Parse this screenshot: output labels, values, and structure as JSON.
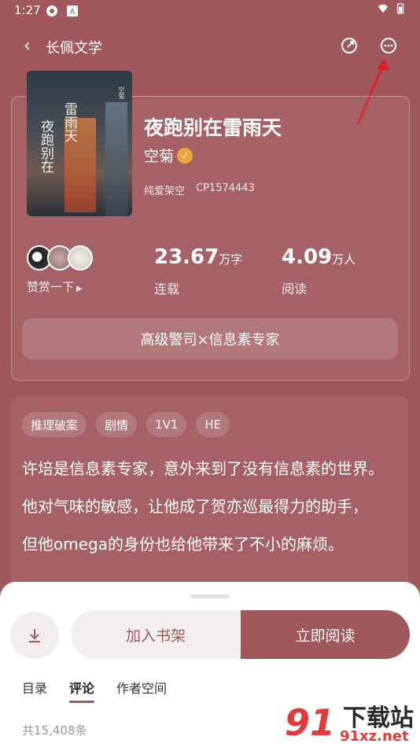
{
  "status_bar": {
    "time": "1:27"
  },
  "nav": {
    "back_label": "长佩文学"
  },
  "book": {
    "title": "夜跑别在雷雨天",
    "author": "空菊",
    "category": "纯爱架空",
    "code": "CP1574443",
    "cover_text_1": "雷雨天",
    "cover_text_2": "夜跑别在",
    "cover_author": "空菊"
  },
  "stats": {
    "praise_label": "赞赏一下",
    "words_value": "23.67",
    "words_unit": "万字",
    "words_label": "连载",
    "reads_value": "4.09",
    "reads_unit": "万人",
    "reads_label": "阅读"
  },
  "tagline": "高级警司×信息素专家",
  "tags": [
    "推理破案",
    "剧情",
    "1V1",
    "HE"
  ],
  "description": [
    "许培是信息素专家，意外来到了没有信息素的世界。",
    "他对气味的敏感，让他成了贺亦巡最得力的助手，",
    "但他omega的身份也给他带来了不小的麻烦。"
  ],
  "actions": {
    "shelf_label": "加入书架",
    "read_label": "立即阅读"
  },
  "tabs": [
    "目录",
    "评论",
    "作者空间"
  ],
  "active_tab": "评论",
  "comment_count": "共15,408条",
  "watermark": {
    "main": "下载站",
    "url": "91xz.net",
    "num": "91"
  },
  "colors": {
    "theme": "#a0585c",
    "watermark_red": "#e23b3b"
  }
}
